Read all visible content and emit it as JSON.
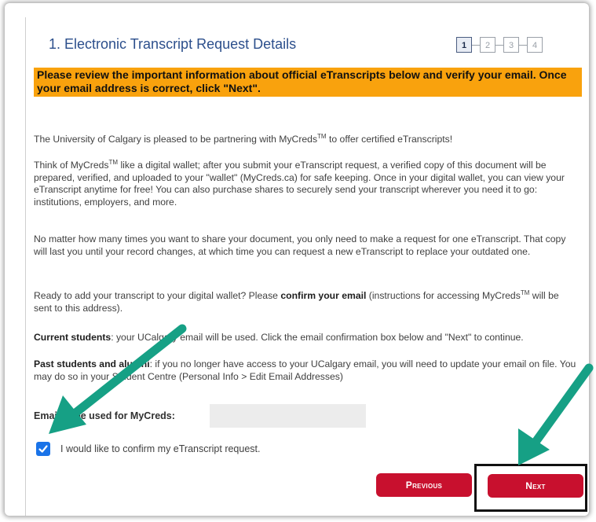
{
  "header": {
    "title": "1. Electronic Transcript Request Details",
    "steps": [
      "1",
      "2",
      "3",
      "4"
    ],
    "active_step": 1
  },
  "notice": "Please review the important information about official eTranscripts below and verify your email. Once your email address is correct, click \"Next\".",
  "content": {
    "p1_pre": "The University of Calgary is pleased to be partnering with MyCreds",
    "p1_tm": "TM",
    "p1_post": " to offer certified eTranscripts!",
    "p2_pre": "Think of MyCreds",
    "p2_tm": "TM",
    "p2_post": " like a digital wallet; after you submit your eTranscript request, a verified copy of this document will be prepared, verified, and uploaded to your \"wallet\" (MyCreds.ca) for safe keeping. Once in your digital wallet, you can view your eTranscript anytime for free! You can also purchase shares to securely send your transcript wherever you need it to go: institutions, employers, and more.",
    "p3": "No matter how many times you want to share your document, you only need to make a request for one eTranscript. That copy will last you until your record changes, at which time you can request a new eTranscript to replace your outdated one.",
    "p4_pre": "Ready to add your transcript to your digital wallet? Please ",
    "p4_bold": "confirm your email",
    "p4_mid": " (instructions for accessing MyCreds",
    "p4_tm": "TM",
    "p4_post": " will be sent to this address).",
    "p5_bold": "Current students",
    "p5_text": ": your UCalgary email will be used. Click the email confirmation box below and \"Next\" to continue.",
    "p6_bold": "Past students and alumni",
    "p6_text": ": if you no longer have access to your UCalgary email, you will need to update your email on file. You may do so in your Student Centre (Personal Info > Edit Email Addresses)"
  },
  "email": {
    "label": "Email to be used for MyCreds:",
    "value": ""
  },
  "confirm": {
    "label": "I would like to confirm my eTranscript request.",
    "checked": true
  },
  "buttons": {
    "previous": "Previous",
    "next": "Next"
  },
  "colors": {
    "title": "#2c4f8c",
    "notice_bg": "#f9a20d",
    "button_bg": "#c8102e",
    "arrow": "#16a085",
    "checkbox": "#1a73e8"
  }
}
